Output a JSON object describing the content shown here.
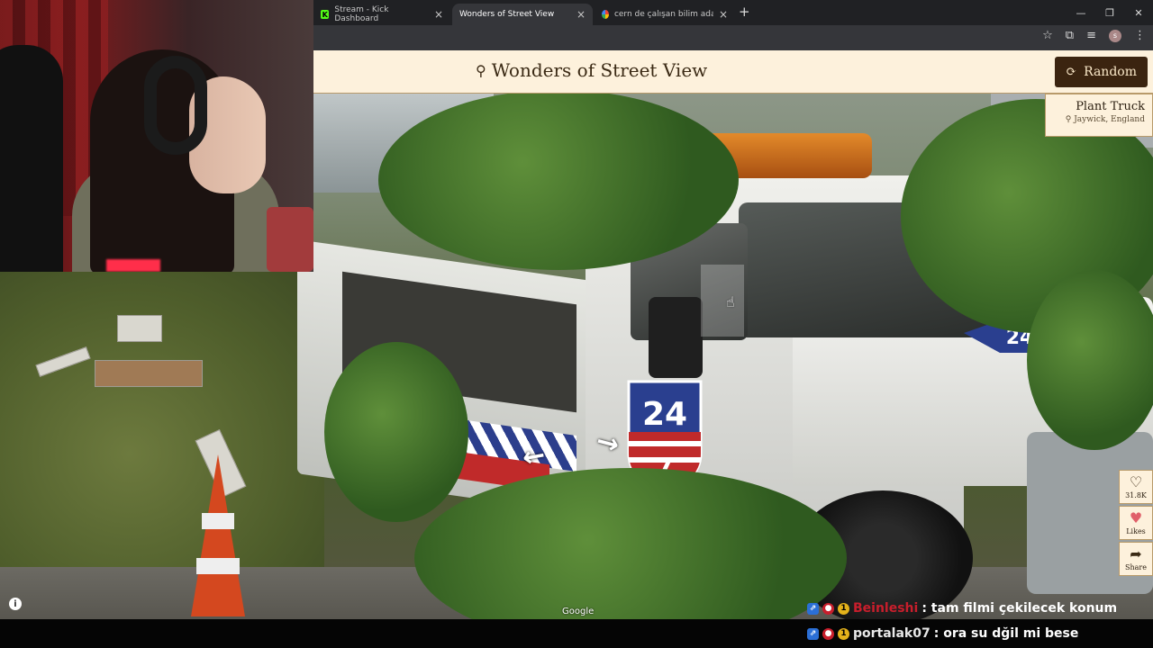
{
  "browser": {
    "tabs": [
      {
        "label": "Stream - Kick Dashboard",
        "icon": "kick-icon"
      },
      {
        "label": "Wonders of Street View",
        "icon": "none"
      },
      {
        "label": "cern de çalışan bilim adamı - G",
        "icon": "google-icon"
      }
    ],
    "window_buttons": [
      "—",
      "❐",
      "✕"
    ]
  },
  "site": {
    "title": "Wonders of Street View",
    "random_label": "Random",
    "location": {
      "name": "Plant Truck",
      "place": "Jaywick, England"
    },
    "actions": {
      "likes_count": "31.8K",
      "likes_label": "Likes",
      "share_label": "Share"
    }
  },
  "streetview": {
    "attribution": "Google",
    "truck_number_top": "24",
    "truck_number_bottom": "7",
    "hood_number": "24"
  },
  "chat": [
    {
      "user": "Beinleshi",
      "text": ": tam filmi çekilecek konum",
      "user_color": "#c81e2c"
    },
    {
      "user": "portalak07",
      "text": ": ora su dğil mi bese",
      "user_color": "#e8e8e8"
    }
  ],
  "colors": {
    "header_bg": "#fdf1dc",
    "button_bg": "#3b2410",
    "title_color": "#3b2a15"
  }
}
